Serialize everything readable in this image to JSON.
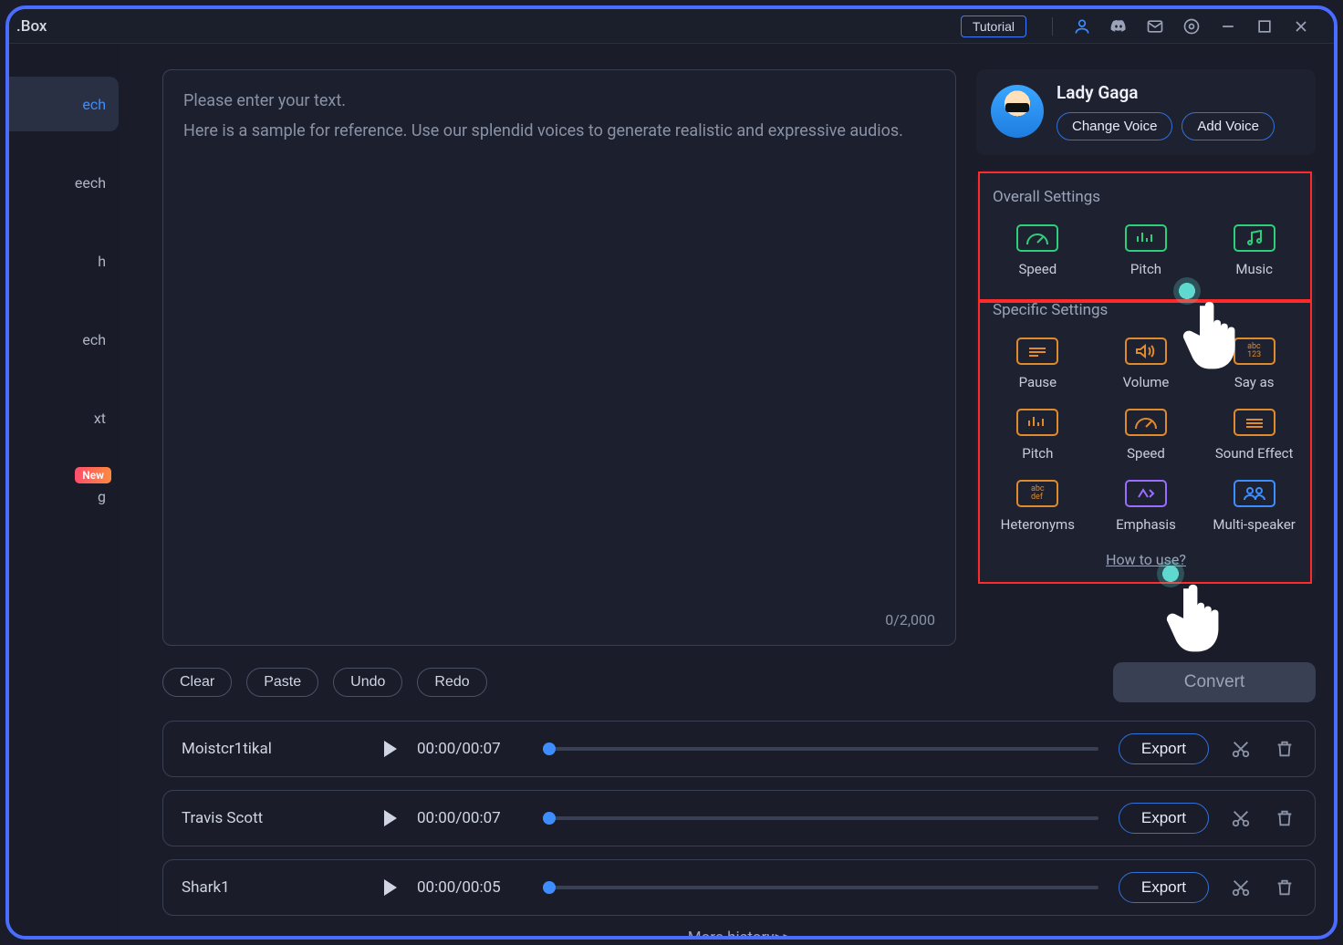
{
  "titlebar": {
    "title": ".Box",
    "tutorial": "Tutorial"
  },
  "sidebar": {
    "items": [
      {
        "label": "ech",
        "active": true
      },
      {
        "label": "eech"
      },
      {
        "label": "h"
      },
      {
        "label": "ech"
      },
      {
        "label": "xt"
      },
      {
        "label": "g",
        "badge": "New"
      }
    ]
  },
  "editor": {
    "placeholder1": "Please enter your text.",
    "placeholder2": "Here is a sample for reference. Use our splendid voices to generate realistic and expressive audios.",
    "counter": "0/2,000"
  },
  "voice": {
    "name": "Lady Gaga",
    "change": "Change Voice",
    "add": "Add Voice"
  },
  "overall": {
    "title": "Overall Settings",
    "items": [
      "Speed",
      "Pitch",
      "Music"
    ]
  },
  "specific": {
    "title": "Specific Settings",
    "items": [
      "Pause",
      "Volume",
      "Say as",
      "Pitch",
      "Speed",
      "Sound Effect",
      "Heteronyms",
      "Emphasis",
      "Multi-speaker"
    ]
  },
  "how_link": "How to use?",
  "actions": {
    "clear": "Clear",
    "paste": "Paste",
    "undo": "Undo",
    "redo": "Redo",
    "convert": "Convert"
  },
  "tracks": [
    {
      "name": "Moistcr1tikal",
      "time": "00:00/00:07",
      "export": "Export"
    },
    {
      "name": "Travis Scott",
      "time": "00:00/00:07",
      "export": "Export"
    },
    {
      "name": "Shark1",
      "time": "00:00/00:05",
      "export": "Export"
    }
  ],
  "more_history": "More history>>"
}
